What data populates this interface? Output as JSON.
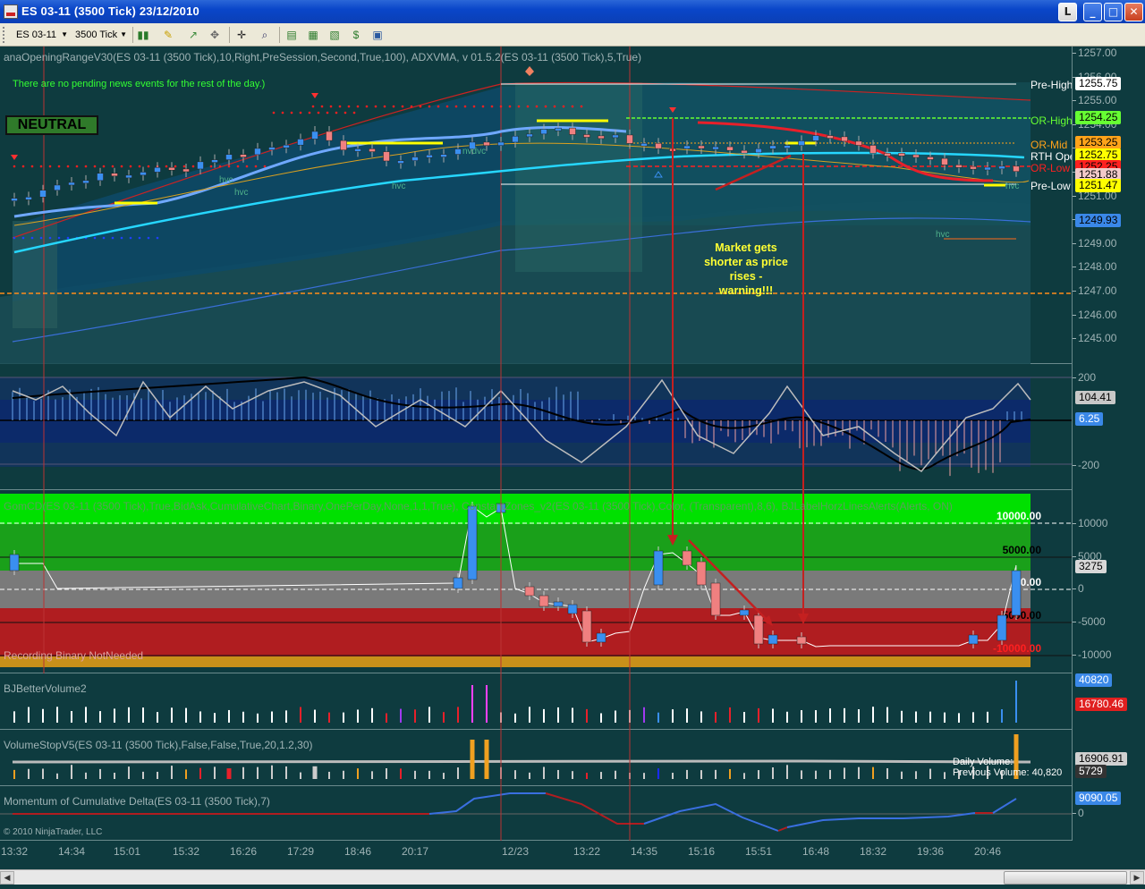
{
  "window": {
    "title": "ES 03-11  (3500 Tick)  23/12/2010",
    "help_label": "L",
    "min_label": "_",
    "max_label": "□",
    "close_label": "✕"
  },
  "toolbar": {
    "instrument": "ES 03-11",
    "period": "3500 Tick",
    "icons": [
      "bar-chart-icon",
      "pencil-icon",
      "cursor-icon",
      "crosshair-icon",
      "zoom-icon",
      "properties-icon",
      "strategies-icon",
      "chart-icon",
      "dollar-icon",
      "data-box-icon"
    ]
  },
  "price_panel": {
    "indicator_label": "anaOpeningRangeV30(ES 03-11  (3500 Tick),10,Right,PreSession,Second,True,100),  ADXVMA,  v 01.5.2(ES 03-11  (3500 Tick),5,True)",
    "status_badge": "NEUTRAL",
    "news_text": "There are no pending news events for the rest of the day.)",
    "annotation": "Market gets shorter as price rises  - warning!!!",
    "levels": [
      {
        "label": "Pre-High",
        "value": "1255.75",
        "color": "#ffffff",
        "bg": "#ffffff",
        "fg": "#000000"
      },
      {
        "label": "OR-High",
        "value": "1254.25",
        "color": "#66ff33",
        "bg": "#66ff33",
        "fg": "#000000"
      },
      {
        "label": "OR-Mid",
        "value": "1253.25",
        "color": "#ffa31a",
        "bg": "#ffa31a",
        "fg": "#000000"
      },
      {
        "label": "RTH Open",
        "value": "1252.75",
        "color": "#ffffff",
        "bg": "#ffff00",
        "fg": "#000000"
      },
      {
        "label": "OR-Low",
        "value": "1252.25",
        "color": "#ff2020",
        "bg": "#ff2020",
        "fg": "#000000"
      },
      {
        "label": "Pre-Low",
        "value": "1251.88",
        "color": "#ffffff",
        "bg": "#f2c9c9",
        "fg": "#000000"
      },
      {
        "label": "",
        "value": "1251.47",
        "color": "#ffffff",
        "bg": "#ffff00",
        "fg": "#000000"
      },
      {
        "label": "",
        "value": "1249.93",
        "color": "#ffffff",
        "bg": "#3a88e8",
        "fg": "#000000"
      }
    ],
    "ticks": [
      "1257.00",
      "1256.00",
      "1255.00",
      "1254.00",
      "1253.00",
      "1252.00",
      "1251.00",
      "1250.00",
      "1249.00",
      "1248.00",
      "1247.00",
      "1246.00",
      "1245.00"
    ],
    "hvc_labels": [
      "hvc",
      "hvc",
      "nvdvc",
      "hvc",
      "hvc",
      "hvc"
    ]
  },
  "osc_panel": {
    "ticks": [
      "200",
      "-200"
    ],
    "value_a": "104.41",
    "value_b": "6.25"
  },
  "gom_panel": {
    "label": "GomCD(ES 03-11  (3500 Tick),True,BidAsk,CumulativeChart,Binary,OnePerDay,None,1,1,True),  ConstantZones_v2(ES 03-11  (3500 Tick),Color, (Transparent),8,6),  BJLabelHorzLinesAlerts(Alerts, ON)",
    "recording_text": "Recording Binary NotNeeded",
    "zone_labels": [
      "10000.00",
      "5000.00",
      "0.00",
      "-5000.00",
      "-10000.00"
    ],
    "ticks": [
      "10000",
      "5000",
      "0",
      "-5000",
      "-10000"
    ],
    "value": "3275"
  },
  "bjvol_panel": {
    "label": "BJBetterVolume2",
    "value_a": "40820",
    "value_b": "16780.46"
  },
  "vstop_panel": {
    "label": "VolumeStopV5(ES 03-11 (3500 Tick),False,False,True,20,1.2,30)",
    "daily_volume": "Daily Volume:",
    "previous_volume": "Previous Volume: 40,820",
    "value_a": "16906.91",
    "value_b": "5729"
  },
  "momentum_panel": {
    "label": "Momentum of Cumulative Delta(ES 03-11 (3500 Tick),7)",
    "copyright": "© 2010 NinjaTrader, LLC",
    "value": "9090.05",
    "zero_tick": "0"
  },
  "x_axis": [
    "13:32",
    "14:34",
    "15:01",
    "15:32",
    "16:26",
    "17:29",
    "18:46",
    "20:17",
    "12/23",
    "13:22",
    "14:35",
    "15:16",
    "15:51",
    "16:48",
    "18:32",
    "19:36",
    "20:46"
  ],
  "colors": {
    "background": "#0e3b3f",
    "up": "#3a8ff0",
    "down": "#f08080",
    "vma": "#26d7ff"
  }
}
